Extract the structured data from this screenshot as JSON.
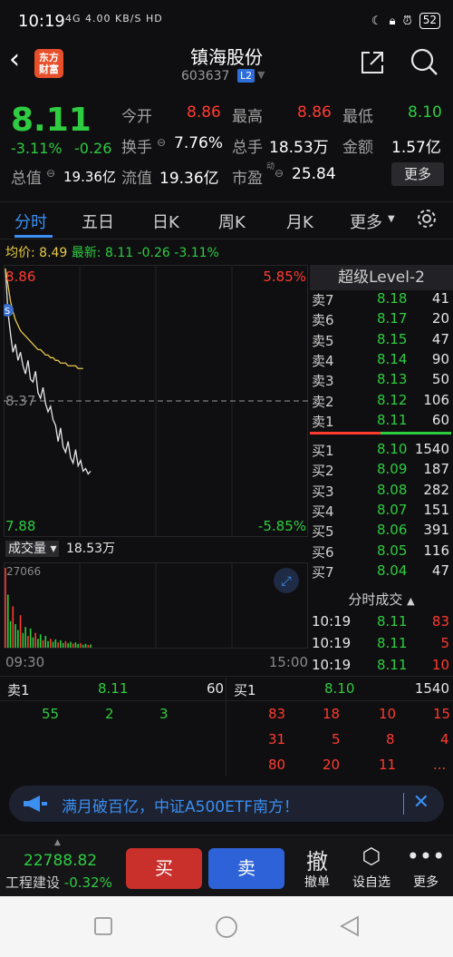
{
  "status": {
    "time": "10:19",
    "net": "4G  4.00 KB/S HD",
    "battery": "52"
  },
  "header": {
    "logo": "东方财富",
    "name": "镇海股份",
    "code": "603637",
    "badge": "L2"
  },
  "quote": {
    "price": "8.11",
    "change_pct": "-3.11%",
    "change": "-0.26",
    "open_label": "今开",
    "open": "8.86",
    "high_label": "最高",
    "high": "8.86",
    "low_label": "最低",
    "low": "8.10",
    "turnover_label": "换手",
    "turnover": "7.76%",
    "volume_label": "总手",
    "volume": "18.53万",
    "amount_label": "金额",
    "amount": "1.57亿",
    "mktcap_label": "总值",
    "mktcap": "19.36亿",
    "float_label": "流值",
    "float": "19.36亿",
    "pe_label": "市盈",
    "pe_sup": "动",
    "pe": "25.84",
    "more": "更多"
  },
  "tabs": [
    "分时",
    "五日",
    "日K",
    "周K",
    "月K",
    "更多"
  ],
  "avgline": {
    "label1": "均价:",
    "avg": "8.49",
    "label2": "最新:",
    "last": "8.11",
    "chg": "-0.26",
    "pct": "-3.11%"
  },
  "chart_axis": {
    "top": "8.86",
    "mid": "8.37",
    "bottom": "7.88",
    "top_pct": "5.85%",
    "bottom_pct": "-5.85%",
    "vol_label": "成交量",
    "vol_value": "18.53万",
    "vol_max": "27066",
    "t_start": "09:30",
    "t_end": "15:00"
  },
  "chart_data": {
    "type": "line",
    "x": [
      0,
      2,
      4,
      6,
      8,
      10,
      12,
      14,
      16,
      18,
      20,
      22,
      24,
      26,
      28,
      30,
      32,
      34,
      36,
      38,
      40,
      42,
      44,
      46,
      48,
      50,
      52,
      54,
      56,
      58,
      60,
      62,
      64,
      66,
      68
    ],
    "series": [
      {
        "values": [
          8.86,
          8.7,
          8.62,
          8.55,
          8.58,
          8.52,
          8.55,
          8.5,
          8.47,
          8.52,
          8.45,
          8.44,
          8.48,
          8.4,
          8.38,
          8.42,
          8.36,
          8.33,
          8.35,
          8.3,
          8.28,
          8.22,
          8.27,
          8.2,
          8.18,
          8.22,
          8.16,
          8.14,
          8.19,
          8.13,
          8.15,
          8.11,
          8.12,
          8.1,
          8.11
        ]
      },
      {
        "values": [
          8.86,
          8.8,
          8.74,
          8.7,
          8.67,
          8.65,
          8.63,
          8.62,
          8.61,
          8.6,
          8.59,
          8.58,
          8.57,
          8.56,
          8.56,
          8.55,
          8.54,
          8.54,
          8.53,
          8.53,
          8.52,
          8.52,
          8.51,
          8.51,
          8.51,
          8.5,
          8.5,
          8.5,
          8.5,
          8.49,
          8.49,
          8.49
        ]
      }
    ],
    "volume": [
      27066,
      18000,
      9000,
      14000,
      8000,
      6000,
      11000,
      5000,
      7000,
      4000,
      6500,
      3500,
      5000,
      3000,
      4500,
      2500,
      4000,
      2200,
      3000,
      2000,
      2800,
      1800,
      2500,
      1600,
      2200,
      1500,
      2000,
      1400,
      1800,
      1200,
      1500,
      1000,
      1300,
      900,
      1100
    ],
    "ylim": [
      7.88,
      8.86
    ],
    "xlim": [
      0,
      240
    ],
    "grid": true
  },
  "level2": {
    "title": "超级Level-2",
    "asks": [
      {
        "label": "卖7",
        "price": "8.18",
        "vol": "41"
      },
      {
        "label": "卖6",
        "price": "8.17",
        "vol": "20"
      },
      {
        "label": "卖5",
        "price": "8.15",
        "vol": "47"
      },
      {
        "label": "卖4",
        "price": "8.14",
        "vol": "90"
      },
      {
        "label": "卖3",
        "price": "8.13",
        "vol": "50"
      },
      {
        "label": "卖2",
        "price": "8.12",
        "vol": "106"
      },
      {
        "label": "卖1",
        "price": "8.11",
        "vol": "60"
      }
    ],
    "bids": [
      {
        "label": "买1",
        "price": "8.10",
        "vol": "1540"
      },
      {
        "label": "买2",
        "price": "8.09",
        "vol": "187"
      },
      {
        "label": "买3",
        "price": "8.08",
        "vol": "282"
      },
      {
        "label": "买4",
        "price": "8.07",
        "vol": "151"
      },
      {
        "label": "买5",
        "price": "8.06",
        "vol": "391"
      },
      {
        "label": "买6",
        "price": "8.05",
        "vol": "116"
      },
      {
        "label": "买7",
        "price": "8.04",
        "vol": "47"
      }
    ],
    "trades_title": "分时成交",
    "trades": [
      {
        "time": "10:19",
        "price": "8.11",
        "vol": "83"
      },
      {
        "time": "10:19",
        "price": "8.11",
        "vol": "5"
      },
      {
        "time": "10:19",
        "price": "8.11",
        "vol": "10"
      }
    ]
  },
  "queue": {
    "ask_label": "卖1",
    "ask_price": "8.11",
    "ask_vol": "60",
    "bid_label": "买1",
    "bid_price": "8.10",
    "bid_vol": "1540",
    "ask_items": [
      "55",
      "2",
      "3"
    ],
    "bid_items": [
      "83",
      "18",
      "10",
      "15",
      "31",
      "5",
      "8",
      "4",
      "80",
      "20",
      "11",
      "..."
    ]
  },
  "banner": {
    "text": "满月破百亿，中证A500ETF南方！"
  },
  "bottom": {
    "index_value": "22788.82",
    "index_name": "工程建设",
    "index_pct": "-0.32%",
    "buy": "买",
    "sell": "卖",
    "cancel": "撤单",
    "cancel_icon": "撤",
    "alert": "设自选",
    "more": "更多"
  }
}
